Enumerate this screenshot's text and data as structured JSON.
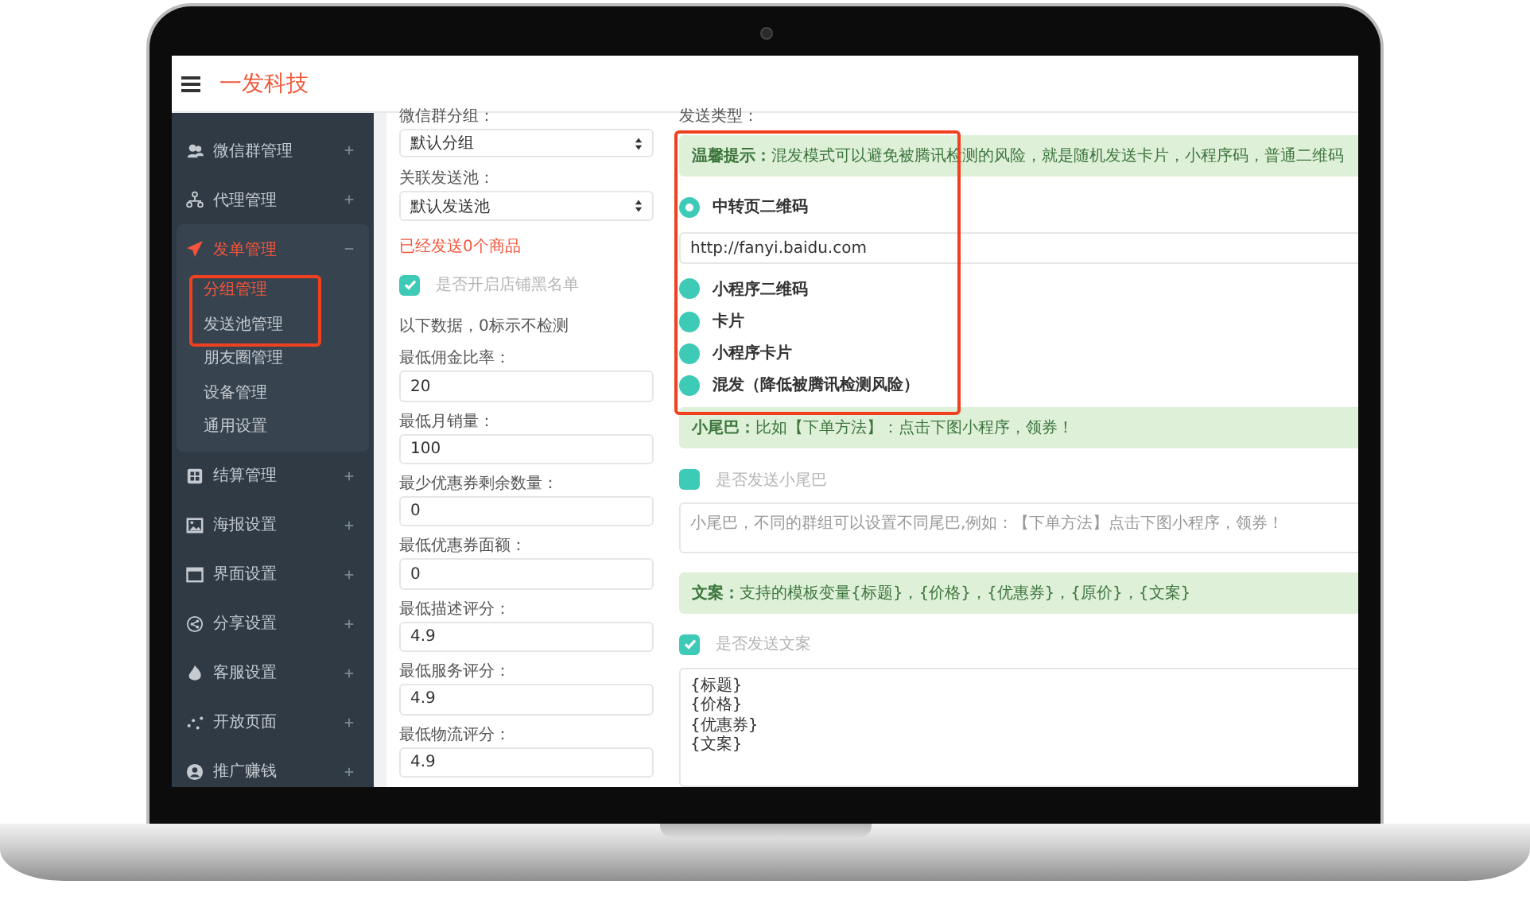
{
  "header": {
    "brand": "一发科技"
  },
  "sidebar": {
    "items": [
      {
        "label": "微信群管理",
        "expanded": false
      },
      {
        "label": "代理管理",
        "expanded": false
      },
      {
        "label": "发单管理",
        "expanded": true,
        "children": [
          {
            "label": "分组管理",
            "selected": true
          },
          {
            "label": "发送池管理",
            "selected": false
          },
          {
            "label": "朋友圈管理",
            "selected": false
          },
          {
            "label": "设备管理",
            "selected": false
          },
          {
            "label": "通用设置",
            "selected": false
          }
        ]
      },
      {
        "label": "结算管理",
        "expanded": false
      },
      {
        "label": "海报设置",
        "expanded": false
      },
      {
        "label": "界面设置",
        "expanded": false
      },
      {
        "label": "分享设置",
        "expanded": false
      },
      {
        "label": "客服设置",
        "expanded": false
      },
      {
        "label": "开放页面",
        "expanded": false
      },
      {
        "label": "推广赚钱",
        "expanded": false
      }
    ]
  },
  "left_form": [
    {
      "kind": "select",
      "label": "微信群分组：",
      "value": "默认分组"
    },
    {
      "kind": "select",
      "label": "关联发送池：",
      "value": "默认发送池"
    },
    {
      "kind": "notice",
      "text": "已经发送0个商品"
    },
    {
      "kind": "checkbox",
      "label": "是否开启店铺黑名单",
      "checked": true
    },
    {
      "kind": "note",
      "text": "以下数据，0标示不检测"
    },
    {
      "kind": "input",
      "label": "最低佣金比率：",
      "value": "20"
    },
    {
      "kind": "input",
      "label": "最低月销量：",
      "value": "100"
    },
    {
      "kind": "input",
      "label": "最少优惠券剩余数量：",
      "value": "0"
    },
    {
      "kind": "input",
      "label": "最低优惠券面额：",
      "value": "0"
    },
    {
      "kind": "input",
      "label": "最低描述评分：",
      "value": "4.9"
    },
    {
      "kind": "input",
      "label": "最低服务评分：",
      "value": "4.9"
    },
    {
      "kind": "input",
      "label": "最低物流评分：",
      "value": "4.9"
    }
  ],
  "right_form": {
    "label": "发送类型：",
    "items": [
      {
        "kind": "alert",
        "text": "**温馨提示：**混发模式可以避免被腾讯检测的风险，就是随机发送卡片，小程序码，普通二维码"
      },
      {
        "kind": "radio",
        "label": "中转页二维码",
        "selected": true
      },
      {
        "kind": "input",
        "value": "http://fanyi.baidu.com"
      },
      {
        "kind": "radio",
        "label": "小程序二维码",
        "selected": false
      },
      {
        "kind": "radio",
        "label": "卡片",
        "selected": false
      },
      {
        "kind": "radio",
        "label": "小程序卡片",
        "selected": false
      },
      {
        "kind": "radio",
        "label": "混发（降低被腾讯检测风险）",
        "selected": false
      },
      {
        "kind": "alert",
        "text": "**小尾巴：**比如【下单方法】：点击下图小程序，领券！"
      },
      {
        "kind": "checkbox",
        "label": "是否发送小尾巴",
        "checked": false
      },
      {
        "kind": "textarea",
        "placeholder": "小尾巴，不同的群组可以设置不同尾巴,例如：【下单方法】点击下图小程序，领券！"
      },
      {
        "kind": "alert",
        "text": "**文案：**支持的模板变量{标题}，{价格}，{优惠券}，{原价}，{文案}"
      },
      {
        "kind": "checkbox",
        "label": "是否发送文案",
        "checked": true
      },
      {
        "kind": "textarea",
        "value": "{标题}\n{价格}\n{优惠券}\n{文案}"
      }
    ]
  }
}
